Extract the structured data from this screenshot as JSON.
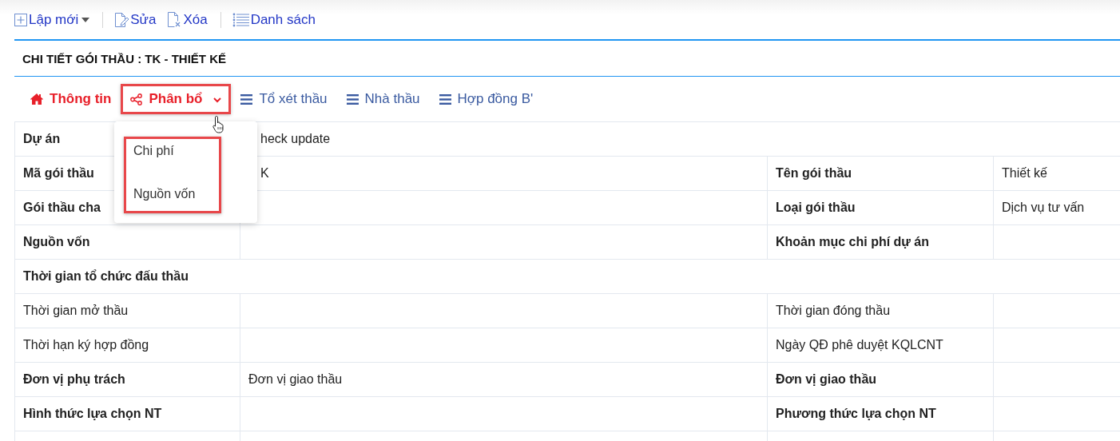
{
  "toolbar": [
    {
      "kind": "new",
      "label": "Lập mới",
      "has_caret": true
    },
    {
      "kind": "separator"
    },
    {
      "kind": "edit",
      "label": "Sửa"
    },
    {
      "kind": "delete",
      "label": "Xóa"
    },
    {
      "kind": "separator"
    },
    {
      "kind": "list",
      "label": "Danh sách"
    }
  ],
  "title": "CHI TIẾT GÓI THẦU : TK - THIẾT KẾ",
  "tabs": [
    {
      "kind": "home",
      "label": "Thông tin",
      "active": true,
      "annotated": false
    },
    {
      "kind": "share",
      "label": "Phân bổ",
      "active": true,
      "annotated": true,
      "expanded": true,
      "menu": {
        "annotated": true,
        "items": [
          "Chi phí",
          "Nguồn vốn"
        ]
      }
    },
    {
      "kind": "bars",
      "label": "Tổ xét thầu",
      "active": false,
      "annotated": false
    },
    {
      "kind": "bars",
      "label": "Nhà thầu",
      "active": false,
      "annotated": false
    },
    {
      "kind": "bars",
      "label": "Hợp đồng B'",
      "active": false,
      "annotated": false
    }
  ],
  "rows": [
    {
      "kind": "wide",
      "cells": [
        {
          "kind": "label",
          "text": "Dự án",
          "bold": true
        },
        {
          "kind": "value",
          "text": "heck update"
        }
      ]
    },
    {
      "kind": "pair",
      "cells": [
        {
          "kind": "label",
          "text": "Mã gói thầu",
          "bold": true
        },
        {
          "kind": "value",
          "text": "K"
        },
        {
          "kind": "label",
          "text": "Tên gói thầu",
          "bold": true
        },
        {
          "kind": "value",
          "text": "Thiết kế"
        }
      ]
    },
    {
      "kind": "pair",
      "cells": [
        {
          "kind": "label",
          "text": "Gói thầu cha",
          "bold": true
        },
        {
          "kind": "empty"
        },
        {
          "kind": "label",
          "text": "Loại gói thầu",
          "bold": true
        },
        {
          "kind": "value",
          "text": "Dịch vụ tư vấn"
        }
      ]
    },
    {
      "kind": "pair",
      "cells": [
        {
          "kind": "label",
          "text": "Nguồn vốn",
          "bold": true
        },
        {
          "kind": "empty"
        },
        {
          "kind": "label",
          "text": "Khoản mục chi phí dự án",
          "bold": true
        },
        {
          "kind": "empty"
        }
      ]
    },
    {
      "kind": "section",
      "cells": [
        {
          "kind": "label",
          "text": "Thời gian tổ chức đấu thầu",
          "bold": true
        }
      ]
    },
    {
      "kind": "pair",
      "cells": [
        {
          "kind": "label",
          "text": "Thời gian mở thầu",
          "bold": false
        },
        {
          "kind": "empty"
        },
        {
          "kind": "label",
          "text": "Thời gian đóng thầu",
          "bold": false
        },
        {
          "kind": "empty"
        }
      ]
    },
    {
      "kind": "pair",
      "cells": [
        {
          "kind": "label",
          "text": "Thời hạn ký hợp đồng",
          "bold": false
        },
        {
          "kind": "empty"
        },
        {
          "kind": "label",
          "text": "Ngày QĐ phê duyệt KQLCNT",
          "bold": false
        },
        {
          "kind": "empty"
        }
      ]
    },
    {
      "kind": "pair",
      "cells": [
        {
          "kind": "label",
          "text": "Đơn vị phụ trách",
          "bold": true
        },
        {
          "kind": "value",
          "text": "Đơn vị giao thầu"
        },
        {
          "kind": "label",
          "text": "Đơn vị giao thầu",
          "bold": true
        },
        {
          "kind": "empty"
        }
      ]
    },
    {
      "kind": "pair",
      "cells": [
        {
          "kind": "label",
          "text": "Hình thức lựa chọn NT",
          "bold": true
        },
        {
          "kind": "empty"
        },
        {
          "kind": "label",
          "text": "Phương thức lựa chọn NT",
          "bold": true
        },
        {
          "kind": "empty"
        }
      ]
    },
    {
      "kind": "pair",
      "cells": [
        {
          "kind": "empty"
        },
        {
          "kind": "empty"
        },
        {
          "kind": "empty"
        },
        {
          "kind": "empty"
        }
      ]
    }
  ]
}
